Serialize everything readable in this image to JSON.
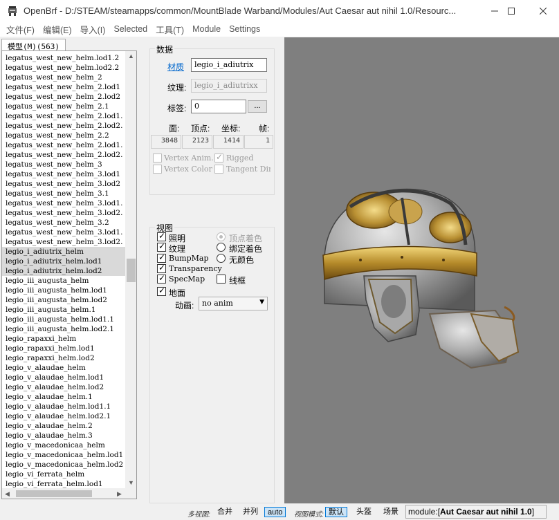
{
  "window": {
    "title": "OpenBrf - D:/STEAM/steamapps/common/MountBlade Warband/Modules/Aut Caesar aut nihil 1.0/Resourc..."
  },
  "menu": [
    "文件(F)",
    "编辑(E)",
    "导入(I)",
    "Selected",
    "工具(T)",
    "Module",
    "Settings"
  ],
  "left_panel": {
    "tab_label": "模型(M)(563)",
    "items": [
      "legatus_west_new_helm.lod1.2",
      "legatus_west_new_helm.lod2.2",
      "legatus_west_new_helm_2",
      "legatus_west_new_helm_2.lod1",
      "legatus_west_new_helm_2.lod2",
      "legatus_west_new_helm_2.1",
      "legatus_west_new_helm_2.lod1.",
      "legatus_west_new_helm_2.lod2.",
      "legatus_west_new_helm_2.2",
      "legatus_west_new_helm_2.lod1.",
      "legatus_west_new_helm_2.lod2.",
      "legatus_west_new_helm_3",
      "legatus_west_new_helm_3.lod1",
      "legatus_west_new_helm_3.lod2",
      "legatus_west_new_helm_3.1",
      "legatus_west_new_helm_3.lod1.",
      "legatus_west_new_helm_3.lod2.",
      "legatus_west_new_helm_3.2",
      "legatus_west_new_helm_3.lod1.",
      "legatus_west_new_helm_3.lod2.",
      "legio_i_adiutrix_helm",
      "legio_i_adiutrix_helm.lod1",
      "legio_i_adiutrix_helm.lod2",
      "legio_iii_augusta_helm",
      "legio_iii_augusta_helm.lod1",
      "legio_iii_augusta_helm.lod2",
      "legio_iii_augusta_helm.1",
      "legio_iii_augusta_helm.lod1.1",
      "legio_iii_augusta_helm.lod2.1",
      "legio_rapaxxi_helm",
      "legio_rapaxxi_helm.lod1",
      "legio_rapaxxi_helm.lod2",
      "legio_v_alaudae_helm",
      "legio_v_alaudae_helm.lod1",
      "legio_v_alaudae_helm.lod2",
      "legio_v_alaudae_helm.1",
      "legio_v_alaudae_helm.lod1.1",
      "legio_v_alaudae_helm.lod2.1",
      "legio_v_alaudae_helm.2",
      "legio_v_alaudae_helm.3",
      "legio_v_macedonicaa_helm",
      "legio_v_macedonicaa_helm.lod1",
      "legio_v_macedonicaa_helm.lod2",
      "legio_vi_ferrata_helm",
      "legio_vi_ferrata_helm.lod1"
    ],
    "selected": [
      20,
      21,
      22
    ]
  },
  "data_group": {
    "title": "数据",
    "material_label": "材质",
    "material_value": "legio_i_adiutrix",
    "texture_label": "纹理:",
    "texture_value": "legio_i_adiutrixx",
    "flags_label": "标签:",
    "flags_value": "0",
    "flags_button": "...",
    "stats_headers": [
      "面:",
      "顶点:",
      "坐标:",
      "帧:"
    ],
    "stats_values": [
      "3848",
      "2123",
      "1414",
      "1"
    ],
    "vertex_anim": "Vertex Anim.",
    "rigged": "Rigged",
    "vertex_color": "Vertex Color",
    "tangent_dirs": "Tangent Dir"
  },
  "view_group": {
    "title": "视图",
    "lighting": "照明",
    "texture": "纹理",
    "bumpmap": "BumpMap",
    "transparency": "Transparency",
    "specmap": "SpecMap",
    "ground": "地面",
    "vertex_coloring": "顶点着色",
    "rigged_coloring": "绑定着色",
    "no_coloring": "无颜色",
    "wireframe": "线框",
    "anim_label": "动画:",
    "anim_value": "no anim"
  },
  "status": {
    "multiview_label": "多视图:",
    "combine": "合并",
    "side_by_side": "并列",
    "auto": "auto",
    "viewmode_label": "视图模式:",
    "default": "默认",
    "helmet": "头盔",
    "scene": "场景",
    "module_prefix": "module:[",
    "module_name": "Aut Caesar aut nihil 1.0",
    "module_suffix": "]"
  },
  "colors": {
    "viewport_bg": "#7f7f7f",
    "selection": "#d9d9d9",
    "link": "#0066cc",
    "active_button": "#cce4f7"
  }
}
